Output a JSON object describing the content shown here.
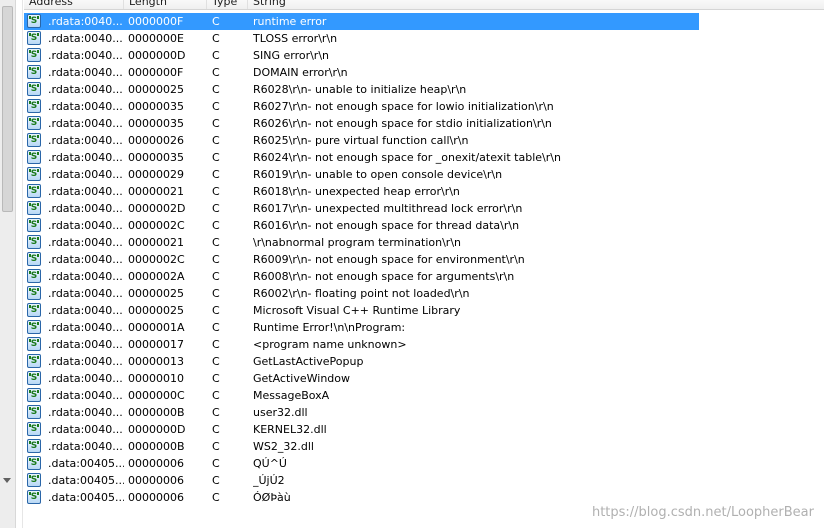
{
  "columns": {
    "address": "Address",
    "length": "Length",
    "type": "Type",
    "string": "String"
  },
  "selected_row": 0,
  "rows": [
    {
      "address": ".rdata:0040...",
      "length": "0000000F",
      "type": "C",
      "string": "runtime error"
    },
    {
      "address": ".rdata:0040...",
      "length": "0000000E",
      "type": "C",
      "string": "TLOSS error\\r\\n"
    },
    {
      "address": ".rdata:0040...",
      "length": "0000000D",
      "type": "C",
      "string": "SING error\\r\\n"
    },
    {
      "address": ".rdata:0040...",
      "length": "0000000F",
      "type": "C",
      "string": "DOMAIN error\\r\\n"
    },
    {
      "address": ".rdata:0040...",
      "length": "00000025",
      "type": "C",
      "string": "R6028\\r\\n- unable to initialize heap\\r\\n"
    },
    {
      "address": ".rdata:0040...",
      "length": "00000035",
      "type": "C",
      "string": "R6027\\r\\n- not enough space for lowio initialization\\r\\n"
    },
    {
      "address": ".rdata:0040...",
      "length": "00000035",
      "type": "C",
      "string": "R6026\\r\\n- not enough space for stdio initialization\\r\\n"
    },
    {
      "address": ".rdata:0040...",
      "length": "00000026",
      "type": "C",
      "string": "R6025\\r\\n- pure virtual function call\\r\\n"
    },
    {
      "address": ".rdata:0040...",
      "length": "00000035",
      "type": "C",
      "string": "R6024\\r\\n- not enough space for _onexit/atexit table\\r\\n"
    },
    {
      "address": ".rdata:0040...",
      "length": "00000029",
      "type": "C",
      "string": "R6019\\r\\n- unable to open console device\\r\\n"
    },
    {
      "address": ".rdata:0040...",
      "length": "00000021",
      "type": "C",
      "string": "R6018\\r\\n- unexpected heap error\\r\\n"
    },
    {
      "address": ".rdata:0040...",
      "length": "0000002D",
      "type": "C",
      "string": "R6017\\r\\n- unexpected multithread lock error\\r\\n"
    },
    {
      "address": ".rdata:0040...",
      "length": "0000002C",
      "type": "C",
      "string": "R6016\\r\\n- not enough space for thread data\\r\\n"
    },
    {
      "address": ".rdata:0040...",
      "length": "00000021",
      "type": "C",
      "string": "\\r\\nabnormal program termination\\r\\n"
    },
    {
      "address": ".rdata:0040...",
      "length": "0000002C",
      "type": "C",
      "string": "R6009\\r\\n- not enough space for environment\\r\\n"
    },
    {
      "address": ".rdata:0040...",
      "length": "0000002A",
      "type": "C",
      "string": "R6008\\r\\n- not enough space for arguments\\r\\n"
    },
    {
      "address": ".rdata:0040...",
      "length": "00000025",
      "type": "C",
      "string": "R6002\\r\\n- floating point not loaded\\r\\n"
    },
    {
      "address": ".rdata:0040...",
      "length": "00000025",
      "type": "C",
      "string": "Microsoft Visual C++ Runtime Library"
    },
    {
      "address": ".rdata:0040...",
      "length": "0000001A",
      "type": "C",
      "string": "Runtime Error!\\n\\nProgram: "
    },
    {
      "address": ".rdata:0040...",
      "length": "00000017",
      "type": "C",
      "string": "<program name unknown>"
    },
    {
      "address": ".rdata:0040...",
      "length": "00000013",
      "type": "C",
      "string": "GetLastActivePopup"
    },
    {
      "address": ".rdata:0040...",
      "length": "00000010",
      "type": "C",
      "string": "GetActiveWindow"
    },
    {
      "address": ".rdata:0040...",
      "length": "0000000C",
      "type": "C",
      "string": "MessageBoxA"
    },
    {
      "address": ".rdata:0040...",
      "length": "0000000B",
      "type": "C",
      "string": "user32.dll"
    },
    {
      "address": ".rdata:0040...",
      "length": "0000000D",
      "type": "C",
      "string": "KERNEL32.dll"
    },
    {
      "address": ".rdata:0040...",
      "length": "0000000B",
      "type": "C",
      "string": "WS2_32.dll"
    },
    {
      "address": ".data:00405...",
      "length": "00000006",
      "type": "C",
      "string": "QÚ^Ú"
    },
    {
      "address": ".data:00405...",
      "length": "00000006",
      "type": "C",
      "string": "_ÚjÚ2"
    },
    {
      "address": ".data:00405...",
      "length": "00000006",
      "type": "C",
      "string": "ÓØÞàù"
    }
  ],
  "icons": {
    "row_icon": "string-literal-icon"
  },
  "watermark": "https://blog.csdn.net/LoopherBear",
  "colors": {
    "selection": "#3399ff",
    "icon_border": "#2a66a8",
    "icon_glyph": "#1b7a1b"
  }
}
